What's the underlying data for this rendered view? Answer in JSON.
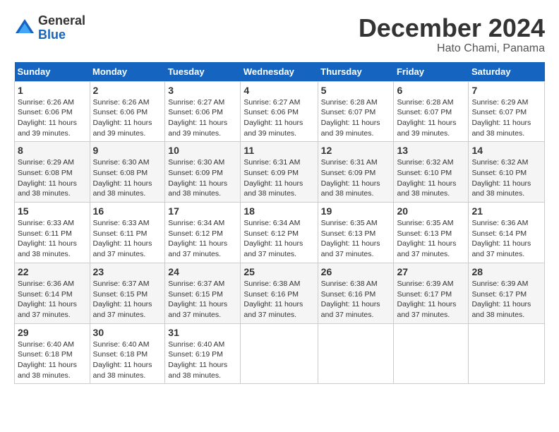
{
  "header": {
    "logo_line1": "General",
    "logo_line2": "Blue",
    "month": "December 2024",
    "location": "Hato Chami, Panama"
  },
  "days_of_week": [
    "Sunday",
    "Monday",
    "Tuesday",
    "Wednesday",
    "Thursday",
    "Friday",
    "Saturday"
  ],
  "weeks": [
    [
      {
        "day": "1",
        "sunrise": "6:26 AM",
        "sunset": "6:06 PM",
        "daylight": "11 hours and 39 minutes."
      },
      {
        "day": "2",
        "sunrise": "6:26 AM",
        "sunset": "6:06 PM",
        "daylight": "11 hours and 39 minutes."
      },
      {
        "day": "3",
        "sunrise": "6:27 AM",
        "sunset": "6:06 PM",
        "daylight": "11 hours and 39 minutes."
      },
      {
        "day": "4",
        "sunrise": "6:27 AM",
        "sunset": "6:06 PM",
        "daylight": "11 hours and 39 minutes."
      },
      {
        "day": "5",
        "sunrise": "6:28 AM",
        "sunset": "6:07 PM",
        "daylight": "11 hours and 39 minutes."
      },
      {
        "day": "6",
        "sunrise": "6:28 AM",
        "sunset": "6:07 PM",
        "daylight": "11 hours and 39 minutes."
      },
      {
        "day": "7",
        "sunrise": "6:29 AM",
        "sunset": "6:07 PM",
        "daylight": "11 hours and 38 minutes."
      }
    ],
    [
      {
        "day": "8",
        "sunrise": "6:29 AM",
        "sunset": "6:08 PM",
        "daylight": "11 hours and 38 minutes."
      },
      {
        "day": "9",
        "sunrise": "6:30 AM",
        "sunset": "6:08 PM",
        "daylight": "11 hours and 38 minutes."
      },
      {
        "day": "10",
        "sunrise": "6:30 AM",
        "sunset": "6:09 PM",
        "daylight": "11 hours and 38 minutes."
      },
      {
        "day": "11",
        "sunrise": "6:31 AM",
        "sunset": "6:09 PM",
        "daylight": "11 hours and 38 minutes."
      },
      {
        "day": "12",
        "sunrise": "6:31 AM",
        "sunset": "6:09 PM",
        "daylight": "11 hours and 38 minutes."
      },
      {
        "day": "13",
        "sunrise": "6:32 AM",
        "sunset": "6:10 PM",
        "daylight": "11 hours and 38 minutes."
      },
      {
        "day": "14",
        "sunrise": "6:32 AM",
        "sunset": "6:10 PM",
        "daylight": "11 hours and 38 minutes."
      }
    ],
    [
      {
        "day": "15",
        "sunrise": "6:33 AM",
        "sunset": "6:11 PM",
        "daylight": "11 hours and 38 minutes."
      },
      {
        "day": "16",
        "sunrise": "6:33 AM",
        "sunset": "6:11 PM",
        "daylight": "11 hours and 37 minutes."
      },
      {
        "day": "17",
        "sunrise": "6:34 AM",
        "sunset": "6:12 PM",
        "daylight": "11 hours and 37 minutes."
      },
      {
        "day": "18",
        "sunrise": "6:34 AM",
        "sunset": "6:12 PM",
        "daylight": "11 hours and 37 minutes."
      },
      {
        "day": "19",
        "sunrise": "6:35 AM",
        "sunset": "6:13 PM",
        "daylight": "11 hours and 37 minutes."
      },
      {
        "day": "20",
        "sunrise": "6:35 AM",
        "sunset": "6:13 PM",
        "daylight": "11 hours and 37 minutes."
      },
      {
        "day": "21",
        "sunrise": "6:36 AM",
        "sunset": "6:14 PM",
        "daylight": "11 hours and 37 minutes."
      }
    ],
    [
      {
        "day": "22",
        "sunrise": "6:36 AM",
        "sunset": "6:14 PM",
        "daylight": "11 hours and 37 minutes."
      },
      {
        "day": "23",
        "sunrise": "6:37 AM",
        "sunset": "6:15 PM",
        "daylight": "11 hours and 37 minutes."
      },
      {
        "day": "24",
        "sunrise": "6:37 AM",
        "sunset": "6:15 PM",
        "daylight": "11 hours and 37 minutes."
      },
      {
        "day": "25",
        "sunrise": "6:38 AM",
        "sunset": "6:16 PM",
        "daylight": "11 hours and 37 minutes."
      },
      {
        "day": "26",
        "sunrise": "6:38 AM",
        "sunset": "6:16 PM",
        "daylight": "11 hours and 37 minutes."
      },
      {
        "day": "27",
        "sunrise": "6:39 AM",
        "sunset": "6:17 PM",
        "daylight": "11 hours and 37 minutes."
      },
      {
        "day": "28",
        "sunrise": "6:39 AM",
        "sunset": "6:17 PM",
        "daylight": "11 hours and 38 minutes."
      }
    ],
    [
      {
        "day": "29",
        "sunrise": "6:40 AM",
        "sunset": "6:18 PM",
        "daylight": "11 hours and 38 minutes."
      },
      {
        "day": "30",
        "sunrise": "6:40 AM",
        "sunset": "6:18 PM",
        "daylight": "11 hours and 38 minutes."
      },
      {
        "day": "31",
        "sunrise": "6:40 AM",
        "sunset": "6:19 PM",
        "daylight": "11 hours and 38 minutes."
      },
      null,
      null,
      null,
      null
    ]
  ]
}
